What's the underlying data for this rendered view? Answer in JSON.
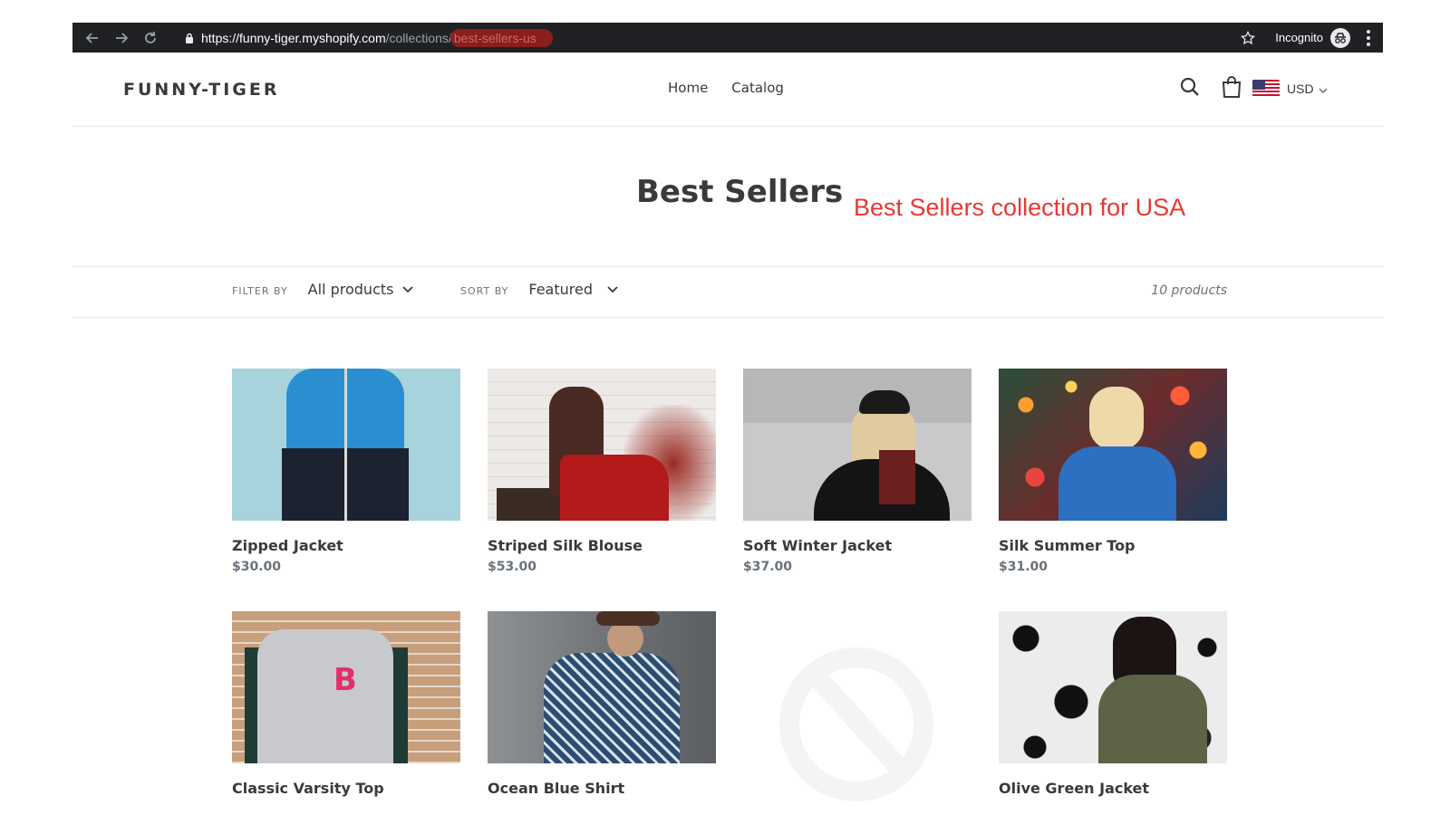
{
  "browser": {
    "url_host": "https://funny-tiger.myshopify.com",
    "url_path": "/collections/",
    "url_slug": "best-sellers-us",
    "incognito_label": "Incognito",
    "icons": [
      "back-arrow-icon",
      "forward-arrow-icon",
      "reload-icon",
      "lock-icon",
      "star-icon",
      "incognito-icon",
      "kebab-menu-icon"
    ]
  },
  "header": {
    "logo": "FUNNY-TIGER",
    "nav": [
      {
        "label": "Home"
      },
      {
        "label": "Catalog"
      }
    ],
    "currency": "USD",
    "icons": [
      "search-icon",
      "cart-icon",
      "us-flag-icon",
      "chevron-down-icon"
    ]
  },
  "collection": {
    "title": "Best Sellers",
    "annotation": "Best Sellers collection for USA",
    "annotation_color": "#e53935"
  },
  "filters": {
    "filter_label": "FILTER BY",
    "filter_value": "All products",
    "sort_label": "SORT BY",
    "sort_value": "Featured",
    "count": "10 products"
  },
  "products": [
    {
      "title": "Zipped Jacket",
      "price": "$30.00"
    },
    {
      "title": "Striped Silk Blouse",
      "price": "$53.00"
    },
    {
      "title": "Soft Winter Jacket",
      "price": "$37.00"
    },
    {
      "title": "Silk Summer Top",
      "price": "$31.00"
    },
    {
      "title": "Classic Varsity Top",
      "price": ""
    },
    {
      "title": "Ocean Blue Shirt",
      "price": ""
    },
    {
      "title": "",
      "price": ""
    },
    {
      "title": "Olive Green Jacket",
      "price": ""
    }
  ]
}
